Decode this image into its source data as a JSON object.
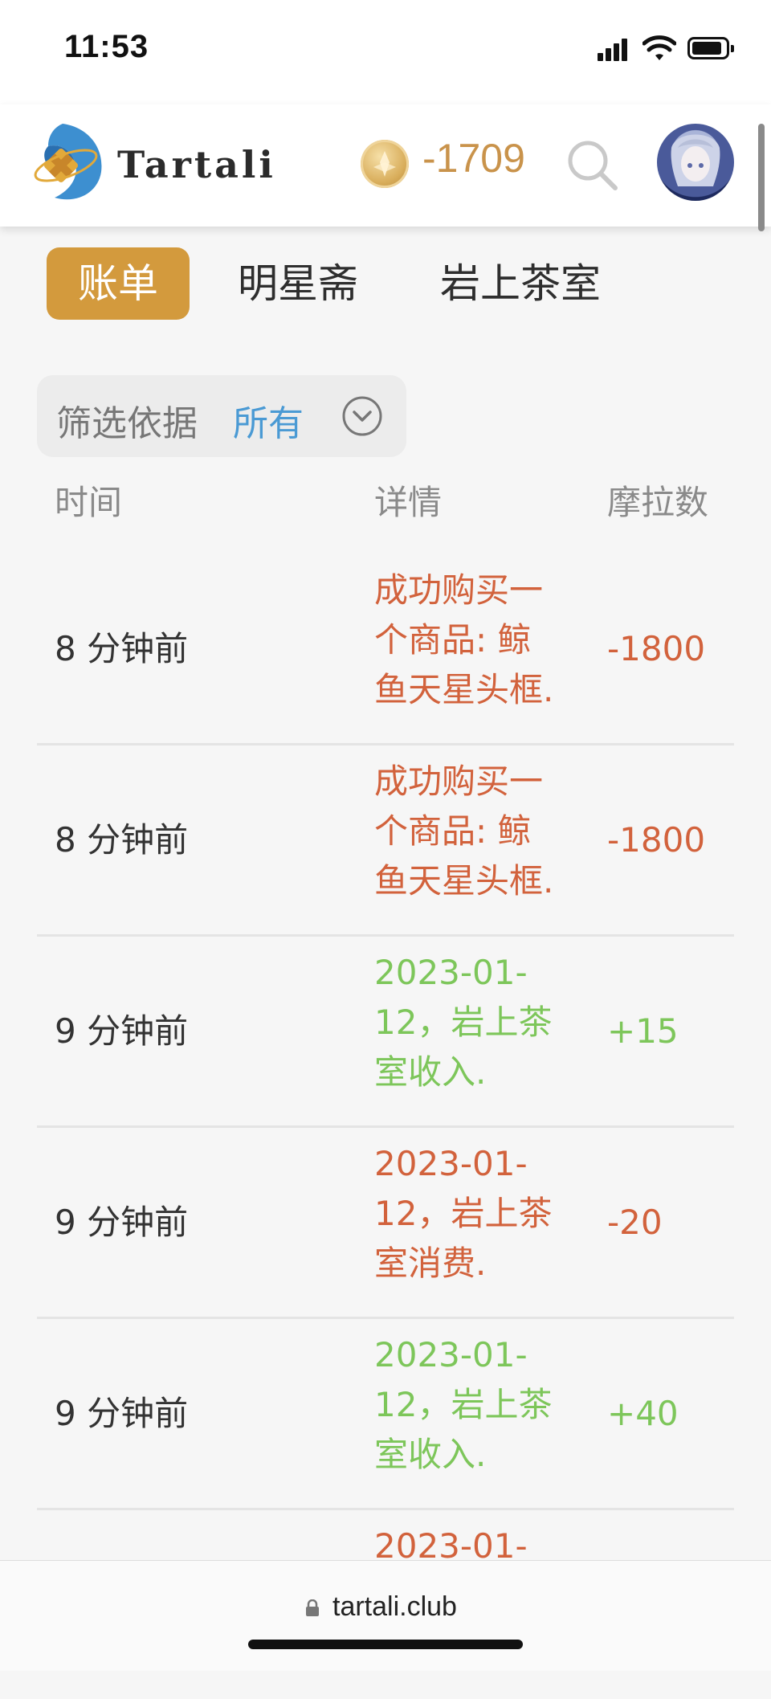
{
  "status_bar": {
    "time": "11:53"
  },
  "header": {
    "brand": "Tartali",
    "coin_balance": "-1709",
    "coin_color": "#c9934b"
  },
  "tabs": [
    {
      "label": "账单",
      "active": true
    },
    {
      "label": "明星斋",
      "active": false
    },
    {
      "label": "岩上茶室",
      "active": false
    }
  ],
  "filter": {
    "label": "筛选依据",
    "value": "所有"
  },
  "table": {
    "headers": [
      "时间",
      "详情",
      "摩拉数"
    ],
    "rows": [
      {
        "time": "8 分钟前",
        "detail": "成功购买一\n个商品: 鲸\n鱼天星头框.",
        "amount": "-1800",
        "type": "neg"
      },
      {
        "time": "8 分钟前",
        "detail": "成功购买一\n个商品: 鲸\n鱼天星头框.",
        "amount": "-1800",
        "type": "neg"
      },
      {
        "time": "9 分钟前",
        "detail": "2023-01-\n12，岩上茶\n室收入.",
        "amount": "+15",
        "type": "pos"
      },
      {
        "time": "9 分钟前",
        "detail": "2023-01-\n12，岩上茶\n室消费.",
        "amount": "-20",
        "type": "neg"
      },
      {
        "time": "9 分钟前",
        "detail": "2023-01-\n12，岩上茶\n室收入.",
        "amount": "+40",
        "type": "pos"
      },
      {
        "time": "",
        "detail": "2023-01-",
        "amount": "",
        "type": "neg"
      }
    ]
  },
  "url_bar": {
    "url": "tartali.club"
  },
  "colors": {
    "accent": "#d39a3d",
    "negative": "#d2623c",
    "positive": "#7dc65a",
    "link": "#4a9ad4"
  }
}
